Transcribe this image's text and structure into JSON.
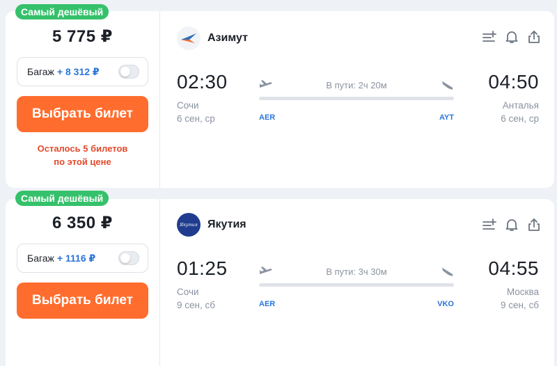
{
  "offers": [
    {
      "badge": "Самый дешёвый",
      "price": "5 775 ₽",
      "baggage_label": "Багаж",
      "baggage_price": "+ 8 312 ₽",
      "buy_label": "Выбрать билет",
      "remain_line1": "Осталось 5 билетов",
      "remain_line2": "по этой цене",
      "airline": "Азимут",
      "depart_time": "02:30",
      "depart_city": "Сочи",
      "depart_date": "6 сен, ср",
      "arrive_time": "04:50",
      "arrive_city": "Анталья",
      "arrive_date": "6 сен, ср",
      "duration": "В пути: 2ч 20м",
      "from_code": "AER",
      "to_code": "AYT"
    },
    {
      "badge": "Самый дешёвый",
      "price": "6 350 ₽",
      "baggage_label": "Багаж",
      "baggage_price": "+ 1116 ₽",
      "buy_label": "Выбрать билет",
      "airline": "Якутия",
      "airline_logo_text": "Якутия",
      "depart_time": "01:25",
      "depart_city": "Сочи",
      "depart_date": "9 сен, сб",
      "arrive_time": "04:55",
      "arrive_city": "Москва",
      "arrive_date": "9 сен, сб",
      "duration": "В пути: 3ч 30м",
      "from_code": "AER",
      "to_code": "VKO"
    }
  ],
  "colors": {
    "badge": "#35c16b",
    "buy_button": "#ff6d2e",
    "remain_text": "#e24a2b",
    "accent_blue": "#2a75d9"
  },
  "icons": [
    "add-to-list-icon",
    "bell-icon",
    "share-icon",
    "takeoff-icon",
    "landing-icon"
  ]
}
